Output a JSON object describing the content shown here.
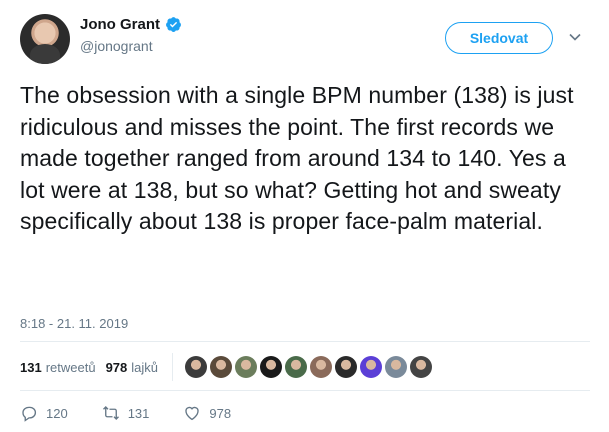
{
  "author": {
    "display_name": "Jono Grant",
    "handle": "@jonogrant",
    "verified": true
  },
  "follow_label": "Sledovat",
  "tweet": {
    "text": "The obsession with a single BPM number (138) is just ridiculous and misses the point. The first records we made together ranged from around 134 to 140. Yes a lot were at 138, but so what? Getting hot and sweaty specifically about 138 is proper face-palm material.",
    "timestamp": "8:18 - 21. 11. 2019"
  },
  "stats": {
    "retweets_count": "131",
    "retweets_label": "retweetů",
    "likes_count": "978",
    "likes_label": "lajků"
  },
  "liker_avatar_colors": [
    "#3b3b3b",
    "#5a4a3a",
    "#6b7d5c",
    "#1a1a1a",
    "#4a6b4a",
    "#8a6a5a",
    "#2a2a2a",
    "#5b3fd6",
    "#7a8a9a",
    "#444444"
  ],
  "actions": {
    "reply_count": "120",
    "retweet_count": "131",
    "like_count": "978"
  },
  "colors": {
    "accent": "#1da1f2",
    "text": "#14171a",
    "secondary": "#657786"
  }
}
